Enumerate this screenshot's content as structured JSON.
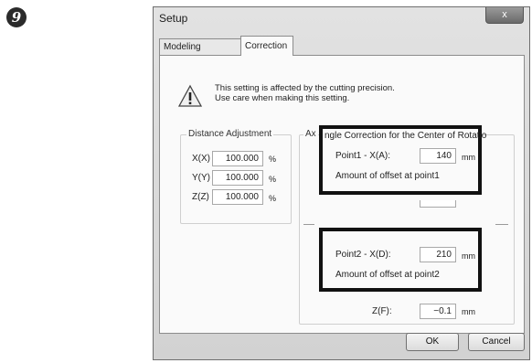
{
  "step_badge": "9",
  "window": {
    "title": "Setup",
    "close_glyph": "x"
  },
  "tabs": [
    {
      "label": "Modeling Machine",
      "active": false
    },
    {
      "label": "Correction",
      "active": true
    }
  ],
  "warning": {
    "line1": "This setting is affected by the cutting precision.",
    "line2": "Use care when making this setting."
  },
  "distance_adjustment": {
    "title": "Distance Adjustment",
    "rows": [
      {
        "label": "X(X)",
        "value": "100.000",
        "unit": "%"
      },
      {
        "label": "Y(Y)",
        "value": "100.000",
        "unit": "%"
      },
      {
        "label": "Z(Z)",
        "value": "100.000",
        "unit": "%"
      }
    ]
  },
  "angle_correction": {
    "title_fragment": "Ax",
    "point1": {
      "label": "Point1 - X(A):",
      "value": "140",
      "unit": "mm",
      "offset_label": "Amount of offset at point1"
    },
    "point2": {
      "label": "Point2 - X(D):",
      "value": "210",
      "unit": "mm",
      "offset_label": "Amount of offset at point2"
    },
    "highlight_title": "ngle Correction for the Center of Rotatio",
    "z_row": {
      "label": "Z(F):",
      "value": "−0.1",
      "unit": "mm"
    }
  },
  "buttons": {
    "ok": "OK",
    "cancel": "Cancel"
  }
}
